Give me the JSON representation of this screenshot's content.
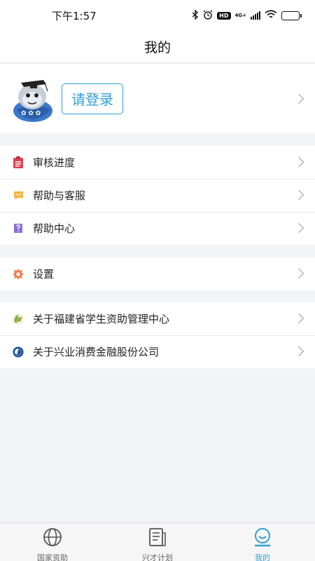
{
  "status_bar": {
    "time": "下午1:57",
    "hd": "HD",
    "network": "4G+"
  },
  "header": {
    "title": "我的"
  },
  "profile": {
    "login_label": "请登录"
  },
  "menu_groups": [
    {
      "items": [
        {
          "label": "审核进度",
          "icon": "clipboard-icon",
          "color": "#e0424f"
        },
        {
          "label": "帮助与客服",
          "icon": "chat-bubble-icon",
          "color": "#f2b53a"
        },
        {
          "label": "帮助中心",
          "icon": "question-icon",
          "color": "#8a6fd8"
        }
      ]
    },
    {
      "items": [
        {
          "label": "设置",
          "icon": "gear-icon",
          "color": "#ee7f4a"
        }
      ]
    },
    {
      "items": [
        {
          "label": "关于福建省学生资助管理中心",
          "icon": "fujian-student-aid-logo-icon",
          "color": "#7cb342"
        },
        {
          "label": "关于兴业消费金融股份公司",
          "icon": "cib-finance-logo-icon",
          "color": "#1f4f9c"
        }
      ]
    }
  ],
  "tabs": [
    {
      "label": "国家资助",
      "icon": "globe-icon",
      "active": false
    },
    {
      "label": "兴才计划",
      "icon": "document-icon",
      "active": false
    },
    {
      "label": "我的",
      "icon": "smiley-icon",
      "active": true
    }
  ],
  "colors": {
    "accent": "#2e9fd8",
    "background": "#f3f4f8"
  }
}
